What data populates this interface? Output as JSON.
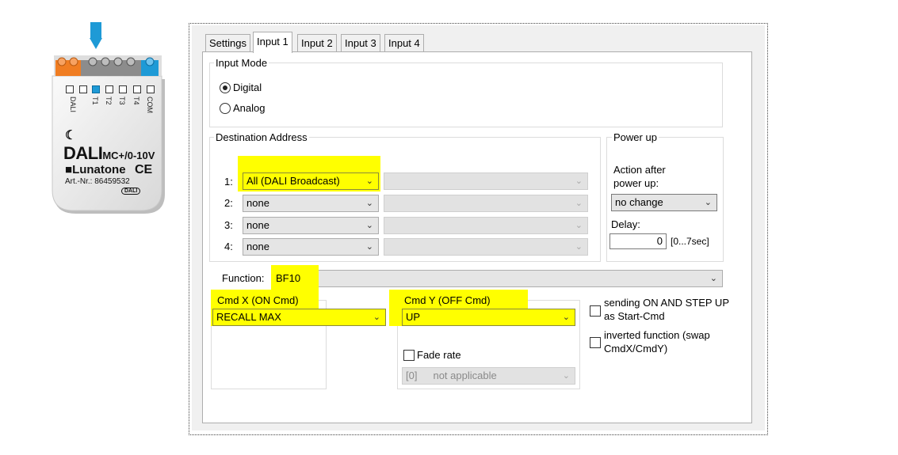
{
  "device": {
    "brand_main": "DALI",
    "brand_suffix": "MC+/0-10V",
    "manufacturer": "Lunatone",
    "ce_mark": "CE",
    "article_number": "Art.-Nr.: 86459532",
    "dali_logo": "DALI",
    "terminals": [
      "DALI",
      "T1",
      "T2",
      "T3",
      "T4",
      "COM"
    ],
    "colors": {
      "orange_terminal": "#f07d22",
      "grey_terminal": "#8c8c8c",
      "blue_terminal": "#1e9ad6",
      "arrow": "#1e9ad6"
    }
  },
  "tabs": [
    {
      "label": "Settings"
    },
    {
      "label": "Input 1"
    },
    {
      "label": "Input 2"
    },
    {
      "label": "Input 3"
    },
    {
      "label": "Input 4"
    }
  ],
  "active_tab": "Input 1",
  "input_mode": {
    "title": "Input Mode",
    "options": [
      {
        "label": "Digital",
        "selected": true
      },
      {
        "label": "Analog",
        "selected": false
      }
    ]
  },
  "destination": {
    "title": "Destination Address",
    "rows": [
      {
        "label": "1:",
        "value": "All (DALI Broadcast)"
      },
      {
        "label": "2:",
        "value": "none"
      },
      {
        "label": "3:",
        "value": "none"
      },
      {
        "label": "4:",
        "value": "none"
      }
    ]
  },
  "power_up": {
    "title": "Power up",
    "action_label_line1": "Action after",
    "action_label_line2": "power up:",
    "action_value": "no change",
    "delay_label": "Delay:",
    "delay_value": "0",
    "delay_range": "[0...7sec]"
  },
  "function": {
    "label": "Function:",
    "value": "BF10"
  },
  "cmd_x": {
    "title": "Cmd X  (ON Cmd)",
    "value": "RECALL MAX"
  },
  "cmd_y": {
    "title": "Cmd Y  (OFF Cmd)",
    "value": "UP",
    "fade_rate_label": "Fade rate",
    "fade_rate_checked": false,
    "fade_index": "[0]",
    "fade_value": "not applicable"
  },
  "options": {
    "start_cmd_line1": "sending ON AND STEP UP",
    "start_cmd_line2": "as Start-Cmd",
    "start_cmd_checked": false,
    "inverted_line1": "inverted function (swap",
    "inverted_line2": "CmdX/CmdY)",
    "inverted_checked": false
  },
  "highlight_color": "#ffff00"
}
